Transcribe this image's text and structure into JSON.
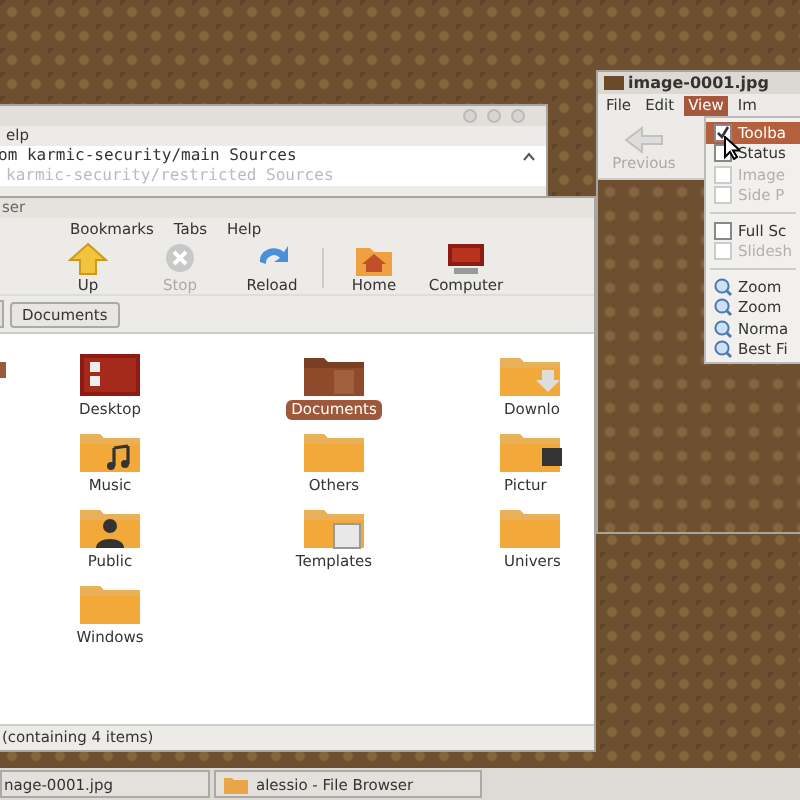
{
  "back_window": {
    "menu": [
      "elp"
    ],
    "lines": [
      "om karmic-security/main Sources",
      "karmic-security/restricted Sources"
    ]
  },
  "file_browser": {
    "title": "ser",
    "menu": [
      "Bookmarks",
      "Tabs",
      "Help"
    ],
    "toolbar": [
      {
        "label": "Up",
        "kind": "up",
        "disabled": false
      },
      {
        "label": "Stop",
        "kind": "stop",
        "disabled": true
      },
      {
        "label": "Reload",
        "kind": "reload",
        "disabled": false
      },
      {
        "label": "Home",
        "kind": "home",
        "disabled": false
      },
      {
        "label": "Computer",
        "kind": "computer",
        "disabled": false
      }
    ],
    "path": [
      "Documents"
    ],
    "items": [
      {
        "label": "Desktop",
        "kind": "desktop",
        "selected": false
      },
      {
        "label": "Documents",
        "kind": "documents",
        "selected": true
      },
      {
        "label": "Downlo",
        "kind": "downloads",
        "selected": false
      },
      {
        "label": "Music",
        "kind": "music",
        "selected": false
      },
      {
        "label": "Others",
        "kind": "folder",
        "selected": false
      },
      {
        "label": "Pictur",
        "kind": "pictures",
        "selected": false
      },
      {
        "label": "Public",
        "kind": "public",
        "selected": false
      },
      {
        "label": "Templates",
        "kind": "templates",
        "selected": false
      },
      {
        "label": "Univers",
        "kind": "folder",
        "selected": false
      },
      {
        "label": "Windows",
        "kind": "folder",
        "selected": false
      }
    ],
    "status": "(containing 4 items)"
  },
  "image_viewer": {
    "title": "image-0001.jpg",
    "menu": [
      {
        "label": "File",
        "selected": false
      },
      {
        "label": "Edit",
        "selected": false
      },
      {
        "label": "View",
        "selected": true
      },
      {
        "label": "Im",
        "selected": false
      }
    ],
    "toolbar": [
      {
        "label": "Previous",
        "disabled": true
      }
    ],
    "view_menu": [
      {
        "kind": "check",
        "label": "Toolba",
        "checked": true,
        "disabled": false,
        "selected": true
      },
      {
        "kind": "check",
        "label": "Status",
        "checked": false,
        "disabled": false,
        "selected": false
      },
      {
        "kind": "check",
        "label": "Image",
        "checked": false,
        "disabled": true,
        "selected": false
      },
      {
        "kind": "check",
        "label": "Side P",
        "checked": false,
        "disabled": true,
        "selected": false
      },
      {
        "kind": "separator"
      },
      {
        "kind": "check",
        "label": "Full Sc",
        "checked": false,
        "disabled": false,
        "selected": false
      },
      {
        "kind": "check",
        "label": "Slidesh",
        "checked": false,
        "disabled": true,
        "selected": false
      },
      {
        "kind": "separator"
      },
      {
        "kind": "zoom",
        "label": "Zoom",
        "disabled": false,
        "selected": false
      },
      {
        "kind": "zoom",
        "label": "Zoom",
        "disabled": false,
        "selected": false
      },
      {
        "kind": "zoom",
        "label": "Norma",
        "disabled": false,
        "selected": false
      },
      {
        "kind": "zoom",
        "label": "Best Fi",
        "disabled": false,
        "selected": false
      }
    ]
  },
  "taskbar": [
    {
      "label": "nage-0001.jpg",
      "icon": false
    },
    {
      "label": "alessio - File Browser",
      "icon": true
    }
  ]
}
